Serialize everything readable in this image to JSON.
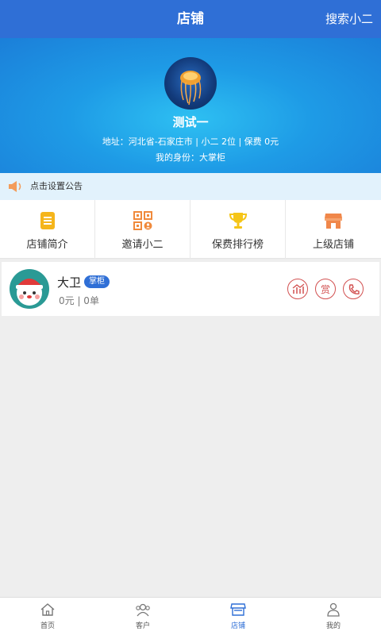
{
  "header": {
    "title": "店铺",
    "search_label": "搜索小二"
  },
  "shop": {
    "name": "测试一",
    "address_line": "地址：河北省-石家庄市 | 小二 2位 | 保费 0元",
    "role_line": "我的身份：大掌柜"
  },
  "notice": {
    "text": "点击设置公告",
    "icon": "speaker-icon"
  },
  "menu": [
    {
      "label": "店铺简介",
      "icon": "document-icon",
      "color": "#f5b51b"
    },
    {
      "label": "邀请小二",
      "icon": "qrcode-icon",
      "color": "#f08a3c"
    },
    {
      "label": "保费排行榜",
      "icon": "trophy-icon",
      "color": "#f5c518"
    },
    {
      "label": "上级店铺",
      "icon": "store-icon",
      "color": "#f0874a"
    }
  ],
  "member": {
    "name": "大卫",
    "badge": "掌柜",
    "stats": "0元 | 0单",
    "actions": [
      {
        "icon": "chart-icon"
      },
      {
        "label": "赏"
      },
      {
        "icon": "phone-icon"
      }
    ]
  },
  "tabbar": [
    {
      "label": "首页",
      "icon": "home-icon",
      "active": false
    },
    {
      "label": "客户",
      "icon": "customers-icon",
      "active": false
    },
    {
      "label": "店铺",
      "icon": "store-icon",
      "active": true
    },
    {
      "label": "我的",
      "icon": "person-icon",
      "active": false
    }
  ],
  "colors": {
    "primary": "#2f6fd6",
    "action_red": "#d25050"
  }
}
